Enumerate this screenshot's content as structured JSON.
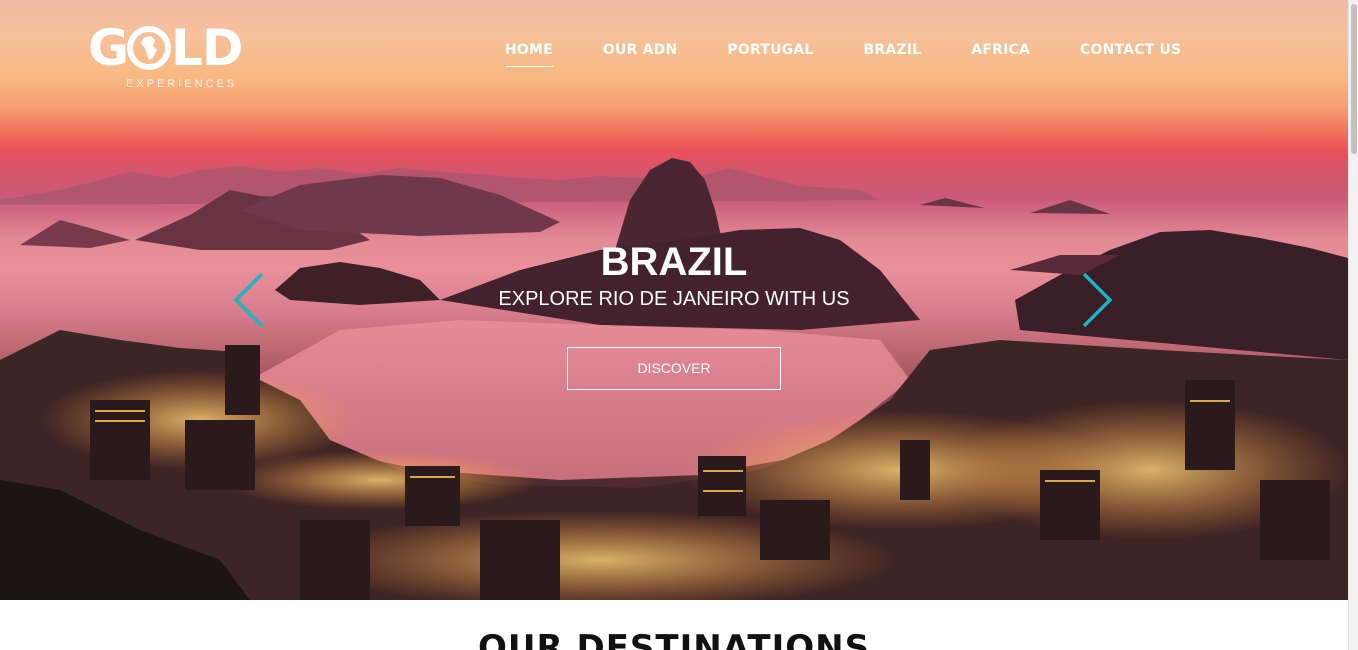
{
  "brand": {
    "name_left": "G",
    "name_right": "LD",
    "tagline": "EXPERIENCES"
  },
  "nav": {
    "items": [
      "HOME",
      "OUR ADN",
      "PORTUGAL",
      "BRAZIL",
      "AFRICA",
      "CONTACT US"
    ],
    "active": "HOME"
  },
  "slide": {
    "title": "BRAZIL",
    "subtitle": "EXPLORE RIO DE JANEIRO WITH US",
    "cta_label": "DISCOVER",
    "arrow_color": "#1cb5c1"
  },
  "destinations": {
    "title": "OUR DESTINATIONS"
  },
  "icons": {
    "logo_globe": "globe-icon",
    "prev": "chevron-left-icon",
    "next": "chevron-right-icon"
  }
}
